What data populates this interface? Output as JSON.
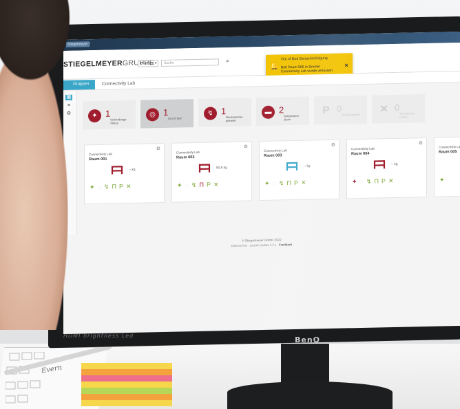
{
  "topbar": {
    "mini_label": "Stiegelmeyer Netzwerk"
  },
  "header": {
    "brand_main": "STIEGELMEYER",
    "brand_light": "GRUPPE",
    "group_select": "Gruppen ▾",
    "search_placeholder": "Suche"
  },
  "notification": {
    "title": "Out of Bed Benachrichtigung",
    "line1": "Bett Raum 565 in Zimmer",
    "line2": "Connectivity Lab wurde verlassen"
  },
  "subbar": {
    "tab_label": "Gruppen",
    "breadcrumb": "Connectivity Lab"
  },
  "rail": {
    "icons": [
      "grid-icon",
      "list-icon",
      "settings-icon"
    ]
  },
  "status_tiles": [
    {
      "icon": "wifi-alert-icon",
      "count": "1",
      "label": "Verbindungs-\nStatus",
      "active": false,
      "muted": false
    },
    {
      "icon": "out-of-bed-icon",
      "count": "1",
      "label": "Out of bed",
      "active": true,
      "muted": false
    },
    {
      "icon": "position-icon",
      "count": "1",
      "label": "Rückenlehne\ngesenkt",
      "active": false,
      "muted": false
    },
    {
      "icon": "bed-exit-icon",
      "count": "2",
      "label": "Bettposition\nalarm",
      "active": false,
      "muted": false
    },
    {
      "icon": "parking-icon",
      "count": "0",
      "label": "Bremse gelöst",
      "active": false,
      "muted": true
    },
    {
      "icon": "tools-icon",
      "count": "0",
      "label": "Technischer\nFehler",
      "active": false,
      "muted": true
    }
  ],
  "rooms": [
    {
      "lab": "Connectivity Lab",
      "room": "Raum 001",
      "weight": "-- kg",
      "bed_color": "#a01d2d",
      "icons": [
        "ok",
        "off",
        "ok",
        "ok",
        "ok",
        "ok"
      ]
    },
    {
      "lab": "Connectivity Lab",
      "room": "Raum 002",
      "weight": "80,8 kg",
      "bed_color": "#a01d2d",
      "icons": [
        "ok",
        "off",
        "ok",
        "bad",
        "ok",
        "ok"
      ]
    },
    {
      "lab": "Connectivity Lab",
      "room": "Raum 003",
      "weight": "-- kg",
      "bed_color": "#3aa7c8",
      "icons": [
        "ok",
        "off",
        "ok",
        "ok",
        "ok",
        "ok"
      ]
    },
    {
      "lab": "Connectivity Lab",
      "room": "Raum 004",
      "weight": "-- kg",
      "bed_color": "#a01d2d",
      "icons": [
        "bad",
        "off",
        "ok",
        "ok",
        "ok",
        "ok"
      ]
    },
    {
      "lab": "Connectivity Lab",
      "room": "Raum 005",
      "weight": "",
      "bed_color": "#a01d2d",
      "icons": [
        "ok"
      ]
    }
  ],
  "footer": {
    "line1": "© Stiegelmeyer GmbH 2022",
    "line2_prefix": "Datenschutz · Letztes Update 2.5.1 ·",
    "line2_link": "Feedback"
  },
  "bezel": {
    "left_text": "HDMI brightness Led",
    "logo": "BenQ"
  },
  "desk": {
    "paper_word": "Evern"
  },
  "colors": {
    "alert": "#a01d2d",
    "ok": "#7fa83a",
    "accent": "#3aa7c8",
    "toast": "#f2c200"
  }
}
